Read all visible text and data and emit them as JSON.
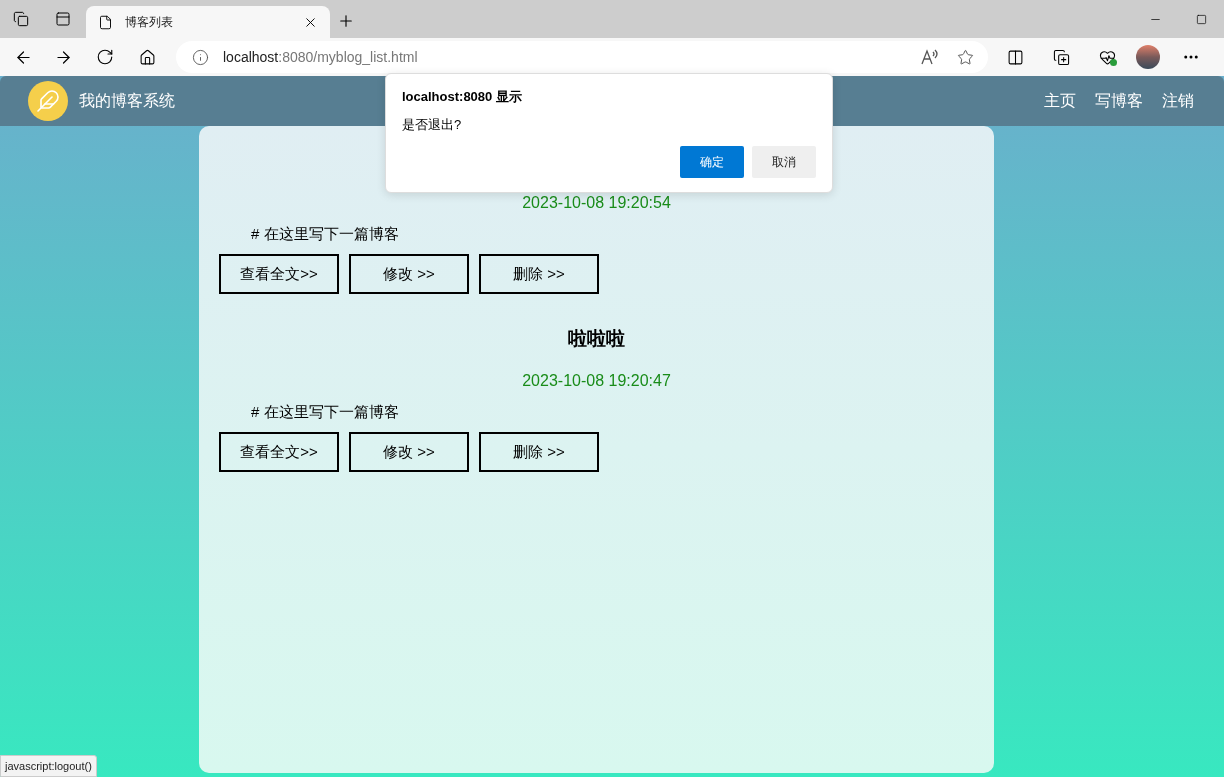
{
  "browser": {
    "tab": {
      "title": "博客列表"
    },
    "url": {
      "host": "localhost",
      "path": ":8080/myblog_list.html"
    }
  },
  "nav": {
    "brand": "我的博客系统",
    "links": [
      "主页",
      "写博客",
      "注销"
    ]
  },
  "posts": [
    {
      "date": "2023-10-08 19:20:54",
      "summary": "# 在这里写下一篇博客",
      "buttons": [
        "查看全文>>",
        "修改 >>",
        "删除 >>"
      ]
    },
    {
      "title": "啦啦啦",
      "date": "2023-10-08 19:20:47",
      "summary": "# 在这里写下一篇博客",
      "buttons": [
        "查看全文>>",
        "修改 >>",
        "删除 >>"
      ]
    }
  ],
  "dialog": {
    "title": "localhost:8080 显示",
    "message": "是否退出?",
    "buttons": [
      {
        "label": "确定",
        "kind": "primary"
      },
      {
        "label": "取消",
        "kind": "secondary"
      }
    ]
  },
  "status_bar": "javascript:logout()"
}
